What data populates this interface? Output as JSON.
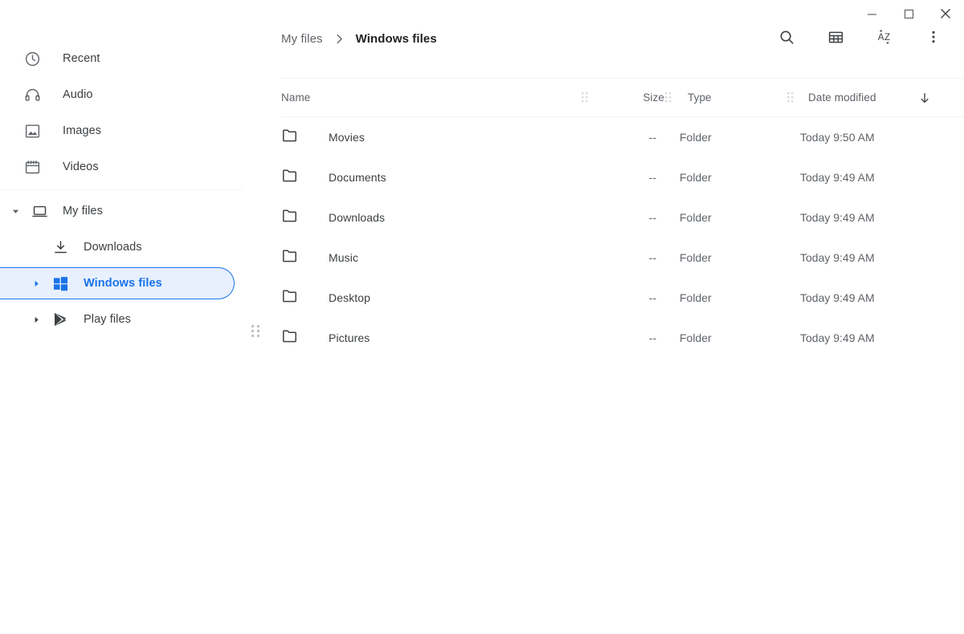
{
  "window_controls": [
    {
      "name": "minimize",
      "label": "Minimize"
    },
    {
      "name": "maximize",
      "label": "Maximize"
    },
    {
      "name": "close",
      "label": "Close"
    }
  ],
  "sidebar": {
    "top_items": [
      {
        "label": "Recent",
        "icon": "clock-icon"
      },
      {
        "label": "Audio",
        "icon": "headphones-icon"
      },
      {
        "label": "Images",
        "icon": "image-icon"
      },
      {
        "label": "Videos",
        "icon": "video-icon"
      }
    ],
    "tree": [
      {
        "label": "My files",
        "icon": "laptop-icon",
        "expanded": true,
        "level": 0,
        "selected": false
      },
      {
        "label": "Downloads",
        "icon": "download-icon",
        "expanded": null,
        "level": 1,
        "selected": false
      },
      {
        "label": "Windows files",
        "icon": "windows-logo-icon",
        "expanded": false,
        "level": 1,
        "selected": true
      },
      {
        "label": "Play files",
        "icon": "google-play-icon",
        "expanded": false,
        "level": 1,
        "selected": false
      }
    ],
    "resize_handle": "panel-resize-handle"
  },
  "header": {
    "breadcrumb": [
      {
        "label": "My files",
        "current": false
      },
      {
        "label": "Windows files",
        "current": true
      }
    ],
    "tools": [
      {
        "name": "search-icon",
        "label": "Search"
      },
      {
        "name": "grid-view-icon",
        "label": "Switch to grid view"
      },
      {
        "name": "sort-az-icon",
        "label": "Sort A-Z"
      },
      {
        "name": "more-vert-icon",
        "label": "More options"
      }
    ]
  },
  "file_table": {
    "columns": [
      {
        "key": "name",
        "label": "Name"
      },
      {
        "key": "size",
        "label": "Size"
      },
      {
        "key": "type",
        "label": "Type"
      },
      {
        "key": "date",
        "label": "Date modified"
      }
    ],
    "sort": {
      "column": "Date modified",
      "direction": "descending",
      "indicator": "arrow-down-icon"
    },
    "rows": [
      {
        "icon": "folder-icon",
        "name": "Movies",
        "size": "--",
        "type": "Folder",
        "date": "Today 9:50 AM"
      },
      {
        "icon": "folder-icon",
        "name": "Documents",
        "size": "--",
        "type": "Folder",
        "date": "Today 9:49 AM"
      },
      {
        "icon": "folder-icon",
        "name": "Downloads",
        "size": "--",
        "type": "Folder",
        "date": "Today 9:49 AM"
      },
      {
        "icon": "folder-icon",
        "name": "Music",
        "size": "--",
        "type": "Folder",
        "date": "Today 9:49 AM"
      },
      {
        "icon": "folder-icon",
        "name": "Desktop",
        "size": "--",
        "type": "Folder",
        "date": "Today 9:49 AM"
      },
      {
        "icon": "folder-icon",
        "name": "Pictures",
        "size": "--",
        "type": "Folder",
        "date": "Today 9:49 AM"
      }
    ]
  },
  "colors": {
    "accent": "#1a73e8",
    "accent_bg": "#e8f0fe",
    "text_primary": "#202124",
    "text_secondary": "#5f6368",
    "divider": "#f1f3f4",
    "windows_logo": "#1a73e8"
  }
}
